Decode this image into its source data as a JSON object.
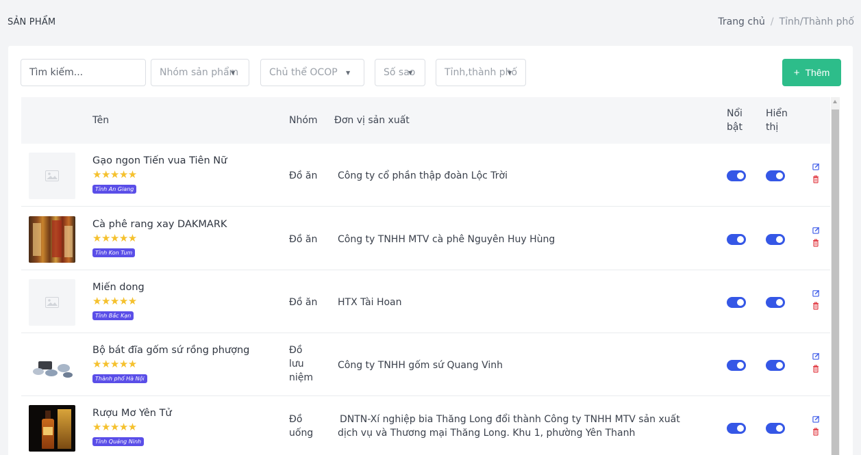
{
  "page": {
    "title": "SẢN PHẨM",
    "breadcrumb": {
      "home": "Trang chủ",
      "separator": "/",
      "current": "Tỉnh/Thành phố"
    }
  },
  "filters": {
    "search_placeholder": "Tìm kiếm...",
    "group_placeholder": "Nhóm sản phẩm",
    "ocop_placeholder": "Chủ thể OCOP",
    "stars_placeholder": "Số sao",
    "province_placeholder": "Tỉnh,thành phố"
  },
  "actions": {
    "add_label": "Thêm",
    "add_icon": "plus-icon"
  },
  "table": {
    "headers": {
      "name": "Tên",
      "group": "Nhóm",
      "maker": "Đơn vị sản xuất",
      "featured_1": "Nổi",
      "featured_2": "bật",
      "visible_1": "Hiển",
      "visible_2": "thị"
    },
    "rows": [
      {
        "name": "Gạo ngon Tiến vua Tiên Nữ",
        "stars": "★★★★★",
        "province": "Tỉnh An Giang",
        "group_1": "Đồ ăn",
        "group_2": "",
        "group_3": "",
        "maker_1": "Công ty cổ phần thập đoàn Lộc Trời",
        "maker_2": "",
        "image": "placeholder"
      },
      {
        "name": "Cà phê rang xay DAKMARK",
        "stars": "★★★★★",
        "province": "Tỉnh Kon Tum",
        "group_1": "Đồ ăn",
        "group_2": "",
        "group_3": "",
        "maker_1": "Công ty TNHH MTV cà phê Nguyên Huy Hùng",
        "maker_2": "",
        "image": "coffee-product-photo"
      },
      {
        "name": "Miến dong",
        "stars": "★★★★★",
        "province": "Tỉnh Bắc Kạn",
        "group_1": "Đồ ăn",
        "group_2": "",
        "group_3": "",
        "maker_1": "HTX Tài Hoan",
        "maker_2": "",
        "image": "placeholder"
      },
      {
        "name": "Bộ bát đĩa gốm sứ rồng phượng",
        "stars": "★★★★★",
        "province": "Thành phố Hà Nội",
        "group_1": "Đồ",
        "group_2": "lưu",
        "group_3": "niệm",
        "maker_1": "Công ty TNHH gốm sứ Quang Vinh",
        "maker_2": "",
        "image": "ceramic-set-photo"
      },
      {
        "name": "Rượu Mơ Yên Tử",
        "stars": "★★★★★",
        "province": "Tỉnh Quảng Ninh",
        "group_1": "Đồ",
        "group_2": "uống",
        "group_3": "",
        "maker_1": "DNTN-Xí nghiệp bia Thăng Long đổi thành Công ty TNHH MTV sản xuất",
        "maker_2": "dịch vụ và Thương mại Thăng Long. Khu 1, phường Yên Thanh",
        "image": "liquor-bottle-photo"
      }
    ]
  },
  "colors": {
    "accent_green": "#2dbd8a",
    "toggle_blue": "#3557e6",
    "badge_purple": "#5a4ee8",
    "star_gold": "#f5c12e",
    "edit_blue": "#3d5be8",
    "delete_red": "#e2434b"
  }
}
